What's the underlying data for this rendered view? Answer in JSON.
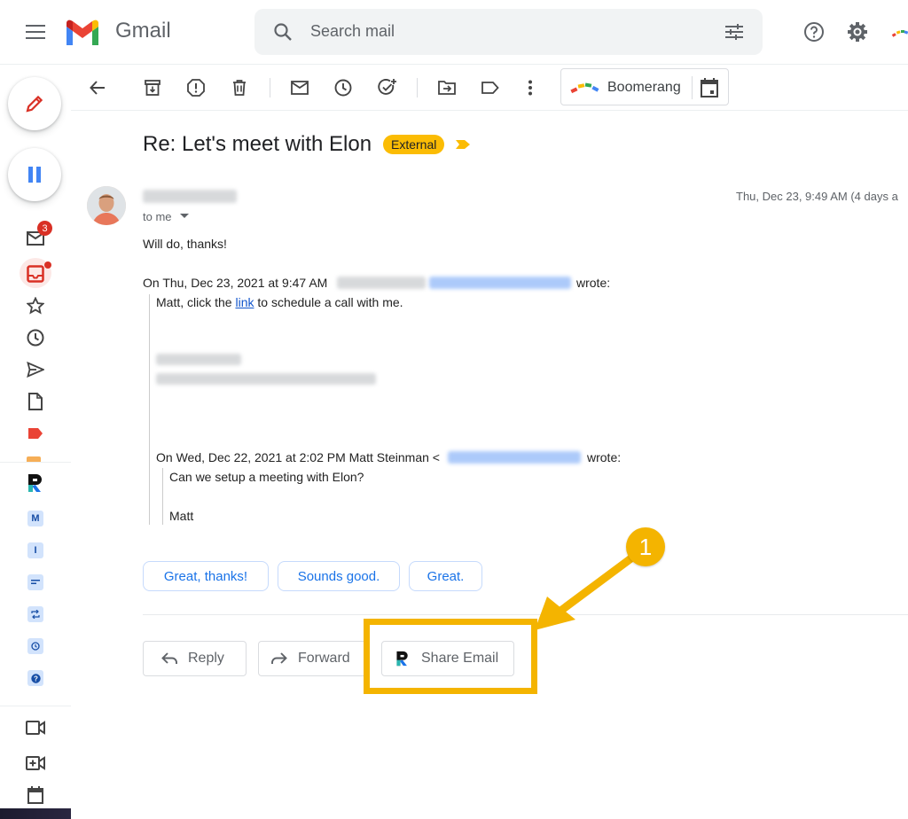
{
  "header": {
    "app_name": "Gmail",
    "search_placeholder": "Search mail",
    "icons": [
      "main-menu-icon",
      "gmail-logo",
      "search-icon",
      "search-options-icon",
      "help-icon",
      "settings-icon"
    ]
  },
  "sidebar": {
    "compose_icon": "pencil-icon",
    "pause_icon": "pause-icon",
    "inbox_badge": "3",
    "extensions": [
      "M",
      "I"
    ]
  },
  "toolbar": {
    "buttons": [
      "back-icon",
      "archive-icon",
      "report-spam-icon",
      "delete-icon",
      "mark-unread-icon",
      "snooze-icon",
      "add-to-tasks-icon",
      "move-to-icon",
      "labels-icon",
      "more-icon"
    ],
    "boomerang_label": "Boomerang"
  },
  "thread": {
    "subject": "Re: Let's meet with Elon",
    "badge": "External"
  },
  "message": {
    "date": "Thu, Dec 23, 9:49 AM (4 days a",
    "to": "to me",
    "body": "Will do, thanks!",
    "quote_header_start": "On Thu, Dec 23, 2021 at 9:47 AM",
    "quote_header_end": "wrote:",
    "quoted_line_before_link": "Matt, click the ",
    "quoted_link": "link",
    "quoted_line_after_link": " to schedule a call with me.",
    "nested_header_start": "On Wed, Dec 22, 2021 at 2:02 PM Matt Steinman <",
    "nested_header_end": "wrote:",
    "nested_body": "Can we setup a meeting with Elon?",
    "nested_signature": "Matt"
  },
  "smart_replies": [
    "Great, thanks!",
    "Sounds good.",
    "Great."
  ],
  "actions": {
    "reply": "Reply",
    "forward": "Forward",
    "share": "Share Email"
  },
  "annotation": {
    "step": "1",
    "color": "#f4b400"
  }
}
